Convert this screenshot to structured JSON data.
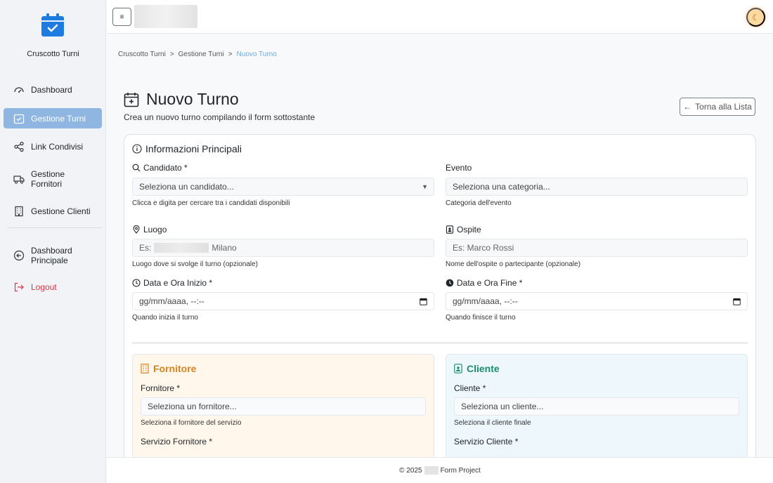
{
  "sidebar": {
    "brand": "Cruscotto Turni",
    "items": [
      {
        "label": "Dashboard"
      },
      {
        "label": "Gestione Turni"
      },
      {
        "label": "Link Condivisi"
      },
      {
        "label": "Gestione Fornitori"
      },
      {
        "label": "Gestione Clienti"
      },
      {
        "label": "Dashboard Principale"
      },
      {
        "label": "Logout"
      }
    ]
  },
  "topbar": {
    "menu_glyph": "≡",
    "theme_glyph": "☾"
  },
  "breadcrumb": [
    "Cruscotto Turni",
    "Gestione Turni",
    "Nuovo Turno"
  ],
  "breadcrumb_sep": ">",
  "page": {
    "title": "Nuovo Turno",
    "subtitle": "Crea un nuovo turno compilando il form sottostante",
    "back_label": "Torna alla Lista",
    "back_glyph": "←"
  },
  "section": {
    "title": "Informazioni Principali"
  },
  "fields": {
    "candidato": {
      "label": "Candidato *",
      "value": "Seleziona un candidato...",
      "help": "Clicca e digita per cercare tra i candidati disponibili",
      "caret": "▼"
    },
    "evento": {
      "label": "Evento",
      "value": "Seleziona una categoria...",
      "help": "Categoria dell'evento"
    },
    "luogo": {
      "label": "Luogo",
      "placeholder_prefix": "Es:",
      "placeholder_suffix": "Milano",
      "help": "Luogo dove si svolge il turno (opzionale)"
    },
    "ospite": {
      "label": "Ospite",
      "placeholder": "Es: Marco Rossi",
      "help": "Nome dell'ospite o partecipante (opzionale)"
    },
    "inizio": {
      "label": "Data e Ora Inizio *",
      "placeholder": "gg/mm/aaaa, --:--",
      "help": "Quando inizia il turno"
    },
    "fine": {
      "label": "Data e Ora Fine *",
      "placeholder": "gg/mm/aaaa, --:--",
      "help": "Quando finisce il turno"
    }
  },
  "fornitore": {
    "title": "Fornitore",
    "field_label": "Fornitore *",
    "value": "Seleziona un fornitore...",
    "help": "Seleziona il fornitore del servizio",
    "next_label": "Servizio Fornitore *"
  },
  "cliente": {
    "title": "Cliente",
    "field_label": "Cliente *",
    "value": "Seleziona un cliente...",
    "help": "Seleziona il cliente finale",
    "next_label": "Servizio Cliente *"
  },
  "footer": {
    "copyright": "© 2025",
    "suffix": "Form Project"
  },
  "colors": {
    "accent": "#8fb6e0",
    "brand": "#1e7be0",
    "danger": "#dc3545",
    "fornitore": "#d9831c",
    "cliente": "#1a8f6c"
  },
  "icons": [
    "calendar-check-icon",
    "dashboard-icon",
    "calendar-icon",
    "share-icon",
    "truck-icon",
    "building-icon",
    "arrow-left-circle-icon",
    "logout-icon",
    "search-icon",
    "info-icon",
    "location-icon",
    "person-badge-icon",
    "clock-icon",
    "calendar-plus-icon",
    "moon-icon",
    "menu-icon"
  ]
}
